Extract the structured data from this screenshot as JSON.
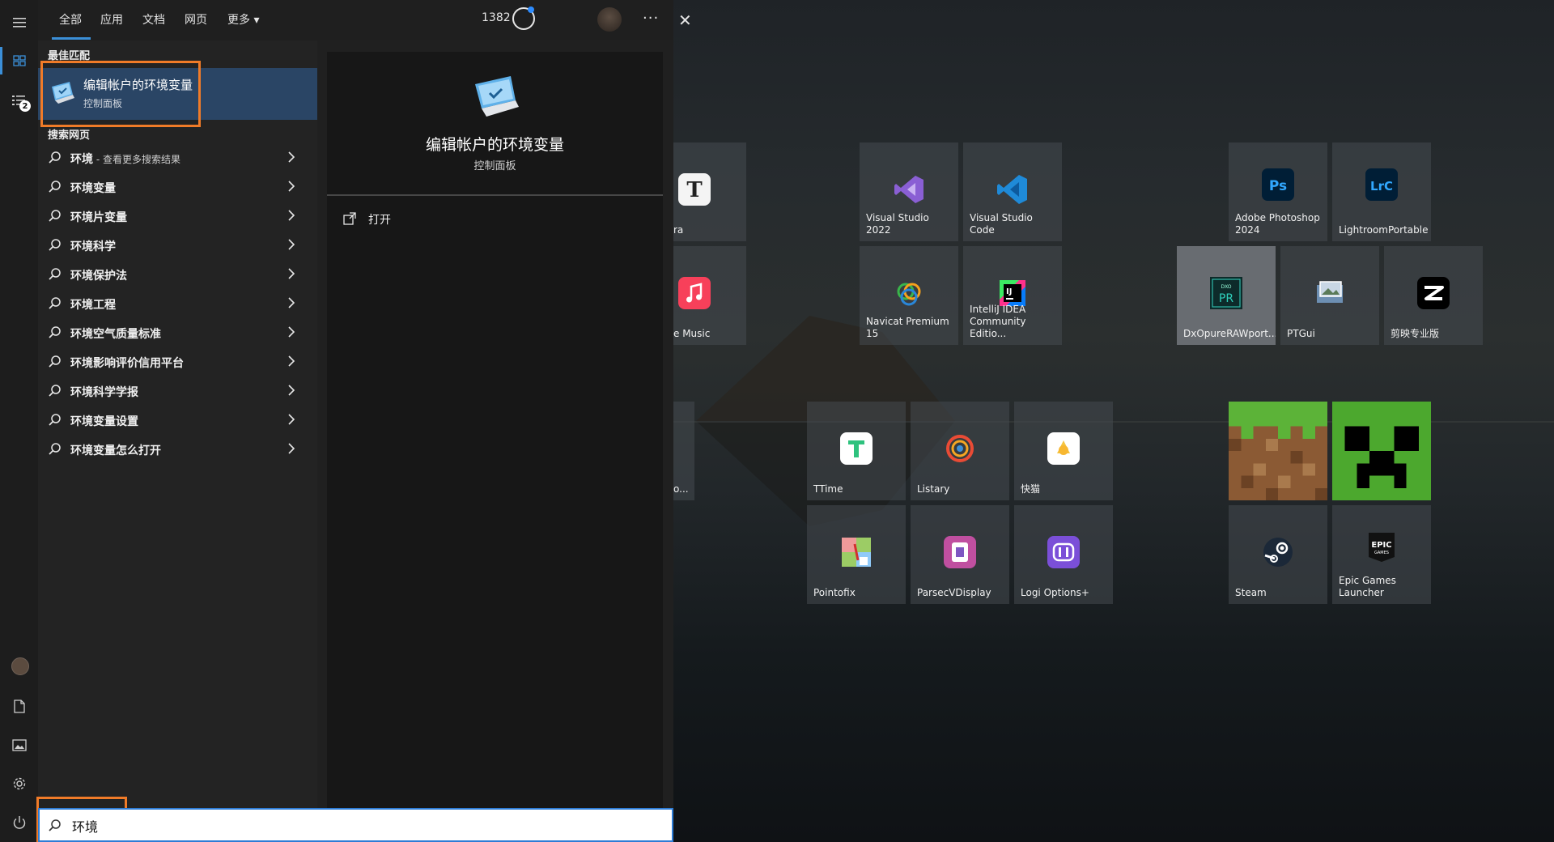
{
  "topbar": {
    "tabs": [
      {
        "label": "全部"
      },
      {
        "label": "应用"
      },
      {
        "label": "文档"
      },
      {
        "label": "网页"
      },
      {
        "label": "更多"
      }
    ],
    "points": "1382",
    "more_label": "···"
  },
  "rail": {
    "badge": "2"
  },
  "best_match": {
    "section_title": "最佳匹配",
    "title": "编辑帐户的环境变量",
    "subtitle": "控制面板"
  },
  "web_search": {
    "section_title": "搜索网页",
    "items": [
      {
        "label": "环境",
        "sub": " - 查看更多搜索结果"
      },
      {
        "label": "环境变量",
        "sub": ""
      },
      {
        "label": "环境片变量",
        "sub": ""
      },
      {
        "label": "环境科学",
        "sub": ""
      },
      {
        "label": "环境保护法",
        "sub": ""
      },
      {
        "label": "环境工程",
        "sub": ""
      },
      {
        "label": "环境空气质量标准",
        "sub": ""
      },
      {
        "label": "环境影响评价信用平台",
        "sub": ""
      },
      {
        "label": "环境科学学报",
        "sub": ""
      },
      {
        "label": "环境变量设置",
        "sub": ""
      },
      {
        "label": "环境变量怎么打开",
        "sub": ""
      }
    ]
  },
  "detail": {
    "title": "编辑帐户的环境变量",
    "subtitle": "控制面板",
    "actions": [
      {
        "label": "打开"
      }
    ]
  },
  "search": {
    "value": "环境"
  },
  "tiles": [
    {
      "label": "ra",
      "icon": "typora-icon"
    },
    {
      "label": "e Music",
      "icon": "apple-music-icon"
    },
    {
      "label": "o...",
      "icon": "partial-icon"
    },
    {
      "label": "Visual Studio 2022",
      "icon": "visual-studio-icon"
    },
    {
      "label": "Visual Studio Code",
      "icon": "vscode-icon"
    },
    {
      "label": "Navicat Premium 15",
      "icon": "navicat-icon"
    },
    {
      "label": "IntelliJ IDEA Community Editio...",
      "icon": "intellij-icon"
    },
    {
      "label": "TTime",
      "icon": "ttime-icon"
    },
    {
      "label": "Listary",
      "icon": "listary-icon"
    },
    {
      "label": "快猫",
      "icon": "kuaimao-icon"
    },
    {
      "label": "Pointofix",
      "icon": "pointofix-icon"
    },
    {
      "label": "ParsecVDisplay",
      "icon": "parsec-icon"
    },
    {
      "label": "Logi Options+",
      "icon": "logi-icon"
    },
    {
      "label": "Adobe Photoshop 2024",
      "icon": "photoshop-icon",
      "icon_text": "Ps"
    },
    {
      "label": "LightroomPortable",
      "icon": "lightroom-icon",
      "icon_text": "LrC"
    },
    {
      "label": "DxOpureRAWport...",
      "icon": "dxo-pureraw-icon",
      "icon_text": "PR"
    },
    {
      "label": "PTGui",
      "icon": "ptgui-icon"
    },
    {
      "label": "剪映专业版",
      "icon": "capcut-icon"
    },
    {
      "label": "",
      "icon": "minecraft-grass-icon"
    },
    {
      "label": "",
      "icon": "minecraft-creeper-icon"
    },
    {
      "label": "Steam",
      "icon": "steam-icon"
    },
    {
      "label": "Epic Games Launcher",
      "icon": "epic-games-icon",
      "icon_text": "EPIC"
    }
  ],
  "colors": {
    "accent": "#3b8fd8",
    "highlight": "#f07b28",
    "selected_row": "#2a4565"
  }
}
